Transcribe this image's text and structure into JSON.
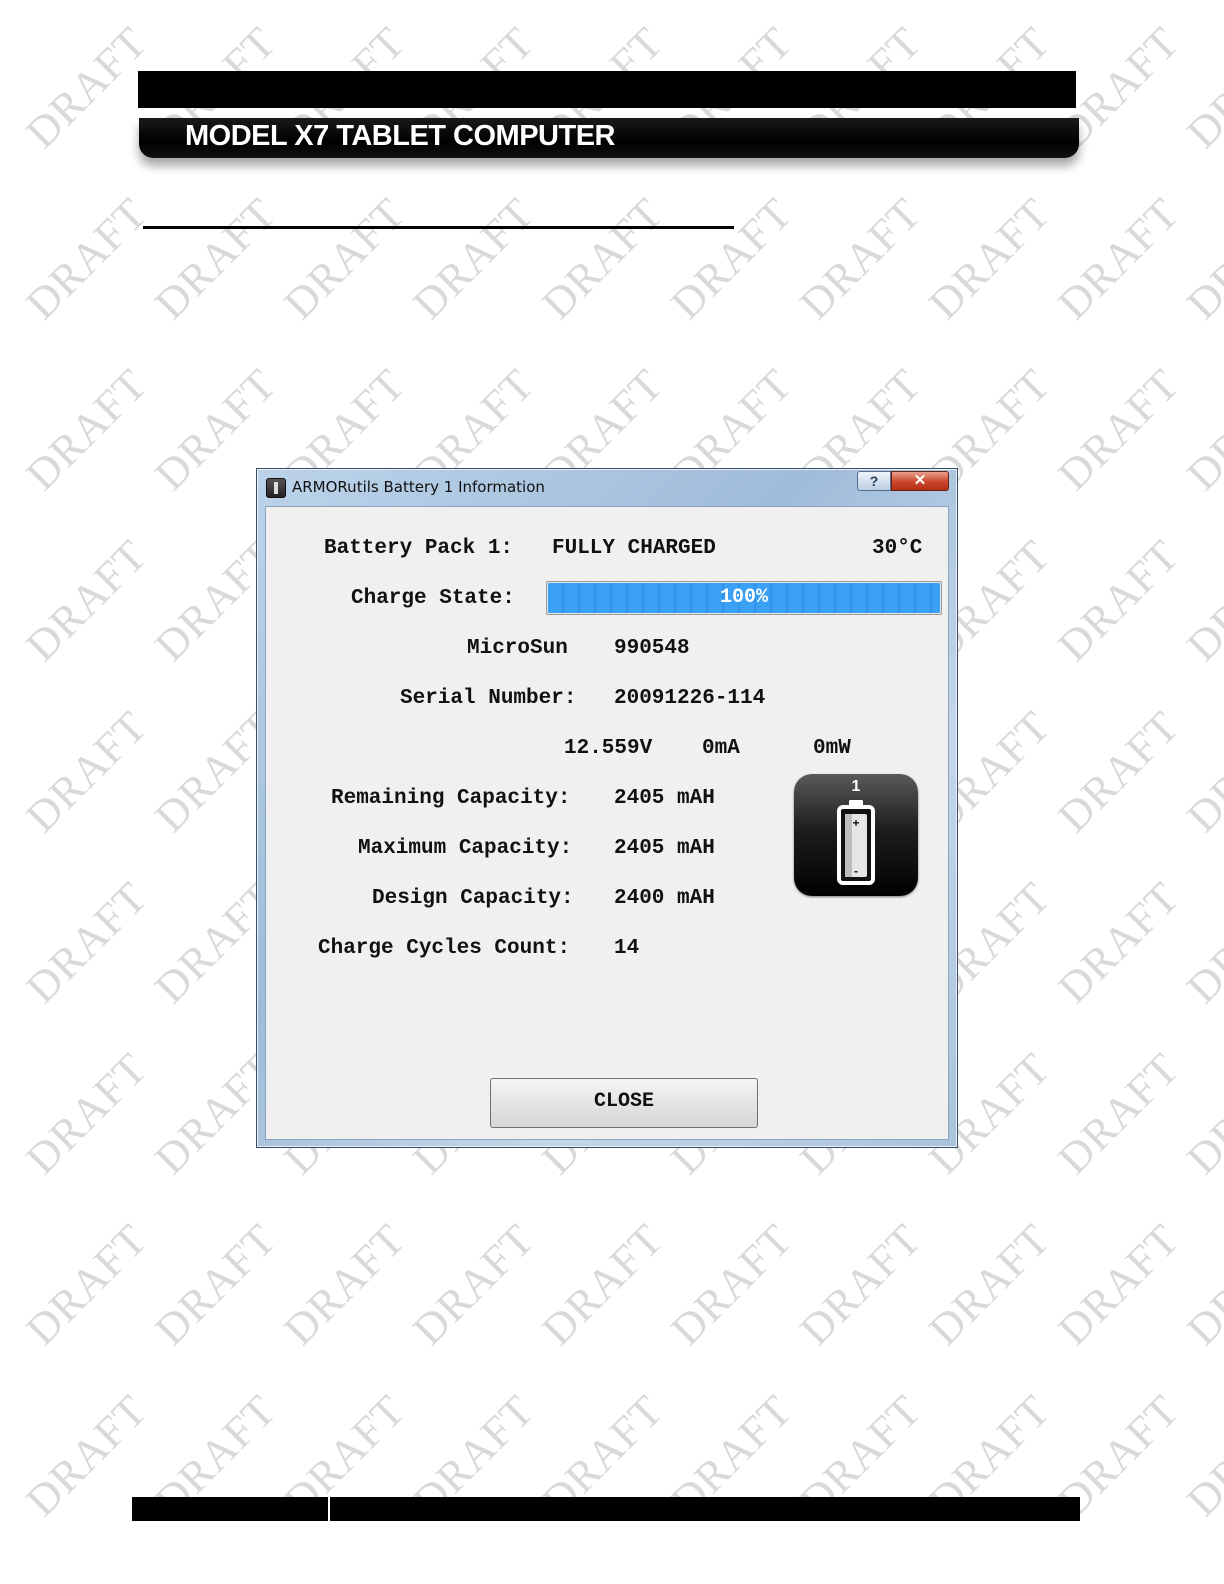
{
  "document": {
    "header_title": "MODEL X7 TABLET COMPUTER",
    "watermark": "DRAFT"
  },
  "dialog": {
    "title": "ARMORutils Battery 1 Information",
    "help_label": "?",
    "close_glyph": "✕",
    "pack_label": "Battery Pack 1:",
    "pack_status": "FULLY CHARGED",
    "temperature": "30°C",
    "charge_state_label": "Charge State:",
    "charge_percent_text": "100%",
    "charge_level": 1.0,
    "manufacturer": "MicroSun",
    "manufacturer_id": "990548",
    "serial_label": "Serial Number:",
    "serial_value": "20091226-114",
    "voltage": "12.559V",
    "current": "0mA",
    "power": "0mW",
    "remaining_label": "Remaining Capacity:",
    "remaining_value": "2405 mAH",
    "maximum_label": "Maximum Capacity:",
    "maximum_value": "2405 mAH",
    "design_label": "Design Capacity:",
    "design_value": "2400 mAH",
    "cycles_label": "Charge Cycles Count:",
    "cycles_value": "14",
    "battery_badge_number": "1",
    "battery_badge_icon": "battery-icon",
    "close_button_label": "CLOSE",
    "accent_color": "#3aa0f4"
  }
}
